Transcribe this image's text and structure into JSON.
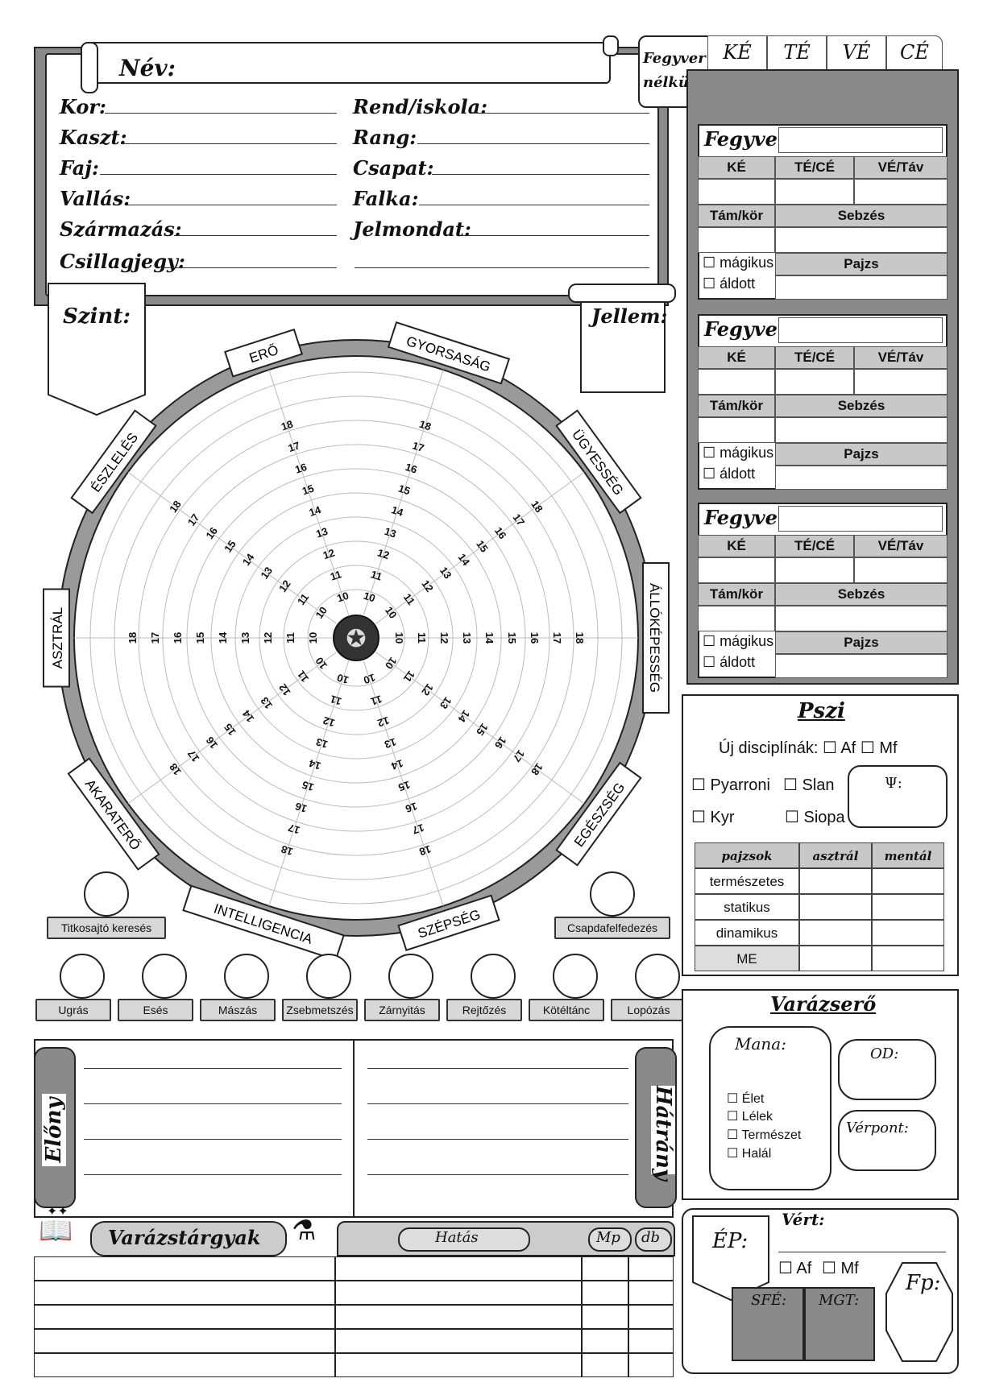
{
  "header": {
    "name_label": "Név:",
    "fields_left": [
      "Kor:",
      "Kaszt:",
      "Faj:",
      "Vallás:",
      "Származás:",
      "Csillagjegy:"
    ],
    "fields_right": [
      "Rend/iskola:",
      "Rang:",
      "Csapat:",
      "Falka:",
      "Jelmondat:",
      ""
    ],
    "szint_label": "Szint:",
    "jellem_label": "Jellem:"
  },
  "unarmed": {
    "label_line1": "Fegyver",
    "label_line2": "nélkül:",
    "cols": [
      "KÉ",
      "TÉ",
      "VÉ",
      "CÉ"
    ]
  },
  "weapons": {
    "title": "Fegyver:",
    "cols1": [
      "KÉ",
      "TÉ/CÉ",
      "VÉ/Táv"
    ],
    "cols2": [
      "Tám/kör",
      "Sebzés"
    ],
    "magic": "mágikus",
    "blessed": "áldott",
    "shield": "Pajzs"
  },
  "stats": {
    "names": [
      "ERŐ",
      "GYORSASÁG",
      "ÜGYESSÉG",
      "ÁLLÓKÉPESSÉG",
      "EGÉSZSÉG",
      "SZÉPSÉG",
      "INTELLIGENCIA",
      "AKARATERŐ",
      "ASZTRÁL",
      "ÉSZLELÉS"
    ],
    "values": [
      "10",
      "11",
      "12",
      "13",
      "14",
      "15",
      "16",
      "17",
      "18"
    ]
  },
  "skills": {
    "top": [
      "Titkosajtó keresés",
      "Csapdafelfedezés"
    ],
    "bottom": [
      "Ugrás",
      "Esés",
      "Mászás",
      "Zsebmetszés",
      "Zárnyitás",
      "Rejtőzés",
      "Kötéltánc",
      "Lopózás"
    ]
  },
  "psi": {
    "title": "Pszi",
    "new_disc": "Új disciplínák:",
    "af": "Af",
    "mf": "Mf",
    "disciplines": [
      "Pyarroni",
      "Slan",
      "Kyr",
      "Siopa"
    ],
    "psi_symbol": "Ψ:",
    "table_headers": [
      "pajzsok",
      "asztrál",
      "mentál"
    ],
    "table_rows": [
      "természetes",
      "statikus",
      "dinamikus",
      "ME"
    ]
  },
  "magic_power": {
    "title": "Varázserő",
    "mana": "Mana:",
    "od": "OD:",
    "verpont": "Vérpont:",
    "types": [
      "Élet",
      "Lélek",
      "Természet",
      "Halál"
    ]
  },
  "advantages": {
    "left": "Előny",
    "right": "Hátrány"
  },
  "items": {
    "title": "Varázstárgyak",
    "effect": "Hatás",
    "mp": "Mp",
    "db": "db"
  },
  "armor": {
    "ep": "ÉP:",
    "vert": "Vért:",
    "af": "Af",
    "mf": "Mf",
    "sfe": "SFÉ:",
    "mgt": "MGT:",
    "fp": "Fp:"
  }
}
